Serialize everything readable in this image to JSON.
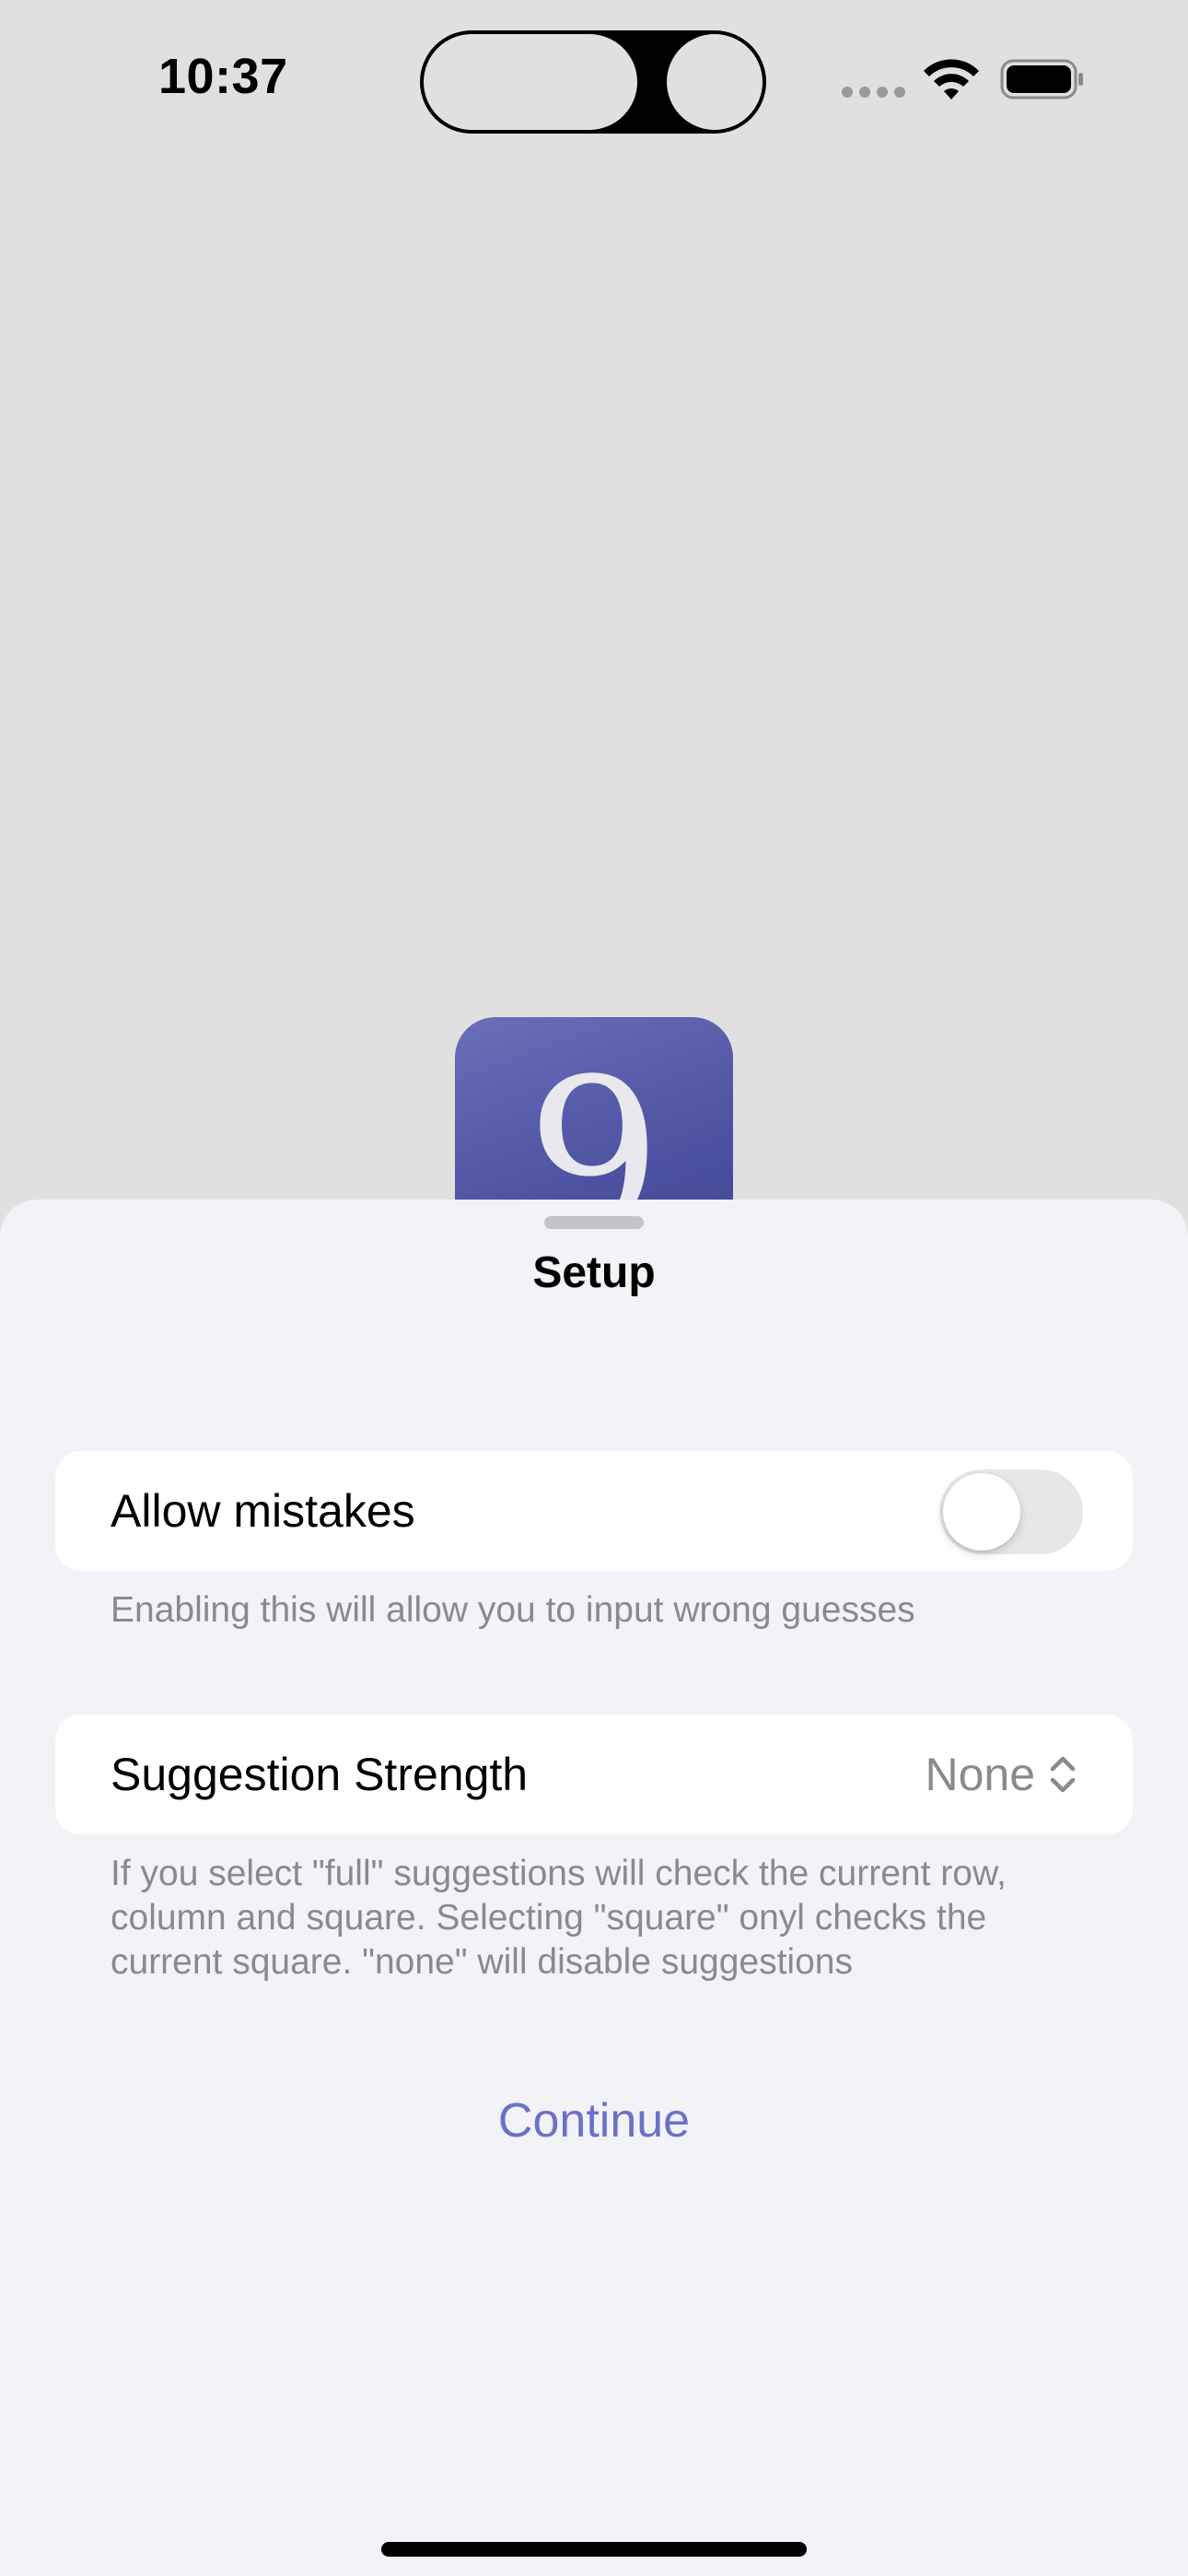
{
  "status_bar": {
    "time": "10:37",
    "icons": [
      "cellular-dots-icon",
      "wifi-icon",
      "battery-icon"
    ]
  },
  "app_icon": {
    "glyph": "9",
    "color": "#4b50a0"
  },
  "sheet": {
    "title": "Setup",
    "allow_mistakes": {
      "label": "Allow mistakes",
      "enabled": false,
      "footnote": "Enabling this will allow you to input wrong guesses"
    },
    "suggestion_strength": {
      "label": "Suggestion Strength",
      "value": "None",
      "icon": "chevron-up-down-icon",
      "footnote": "If you select \"full\" suggestions will check the current row, column and square. Selecting \"square\" onyl checks the current square. \"none\" will disable suggestions"
    },
    "continue_label": "Continue"
  },
  "colors": {
    "background": "#e0e0e0",
    "sheet_background": "#f2f2f7",
    "accent": "#6b70c8",
    "secondary_text": "#8a8a8e"
  }
}
